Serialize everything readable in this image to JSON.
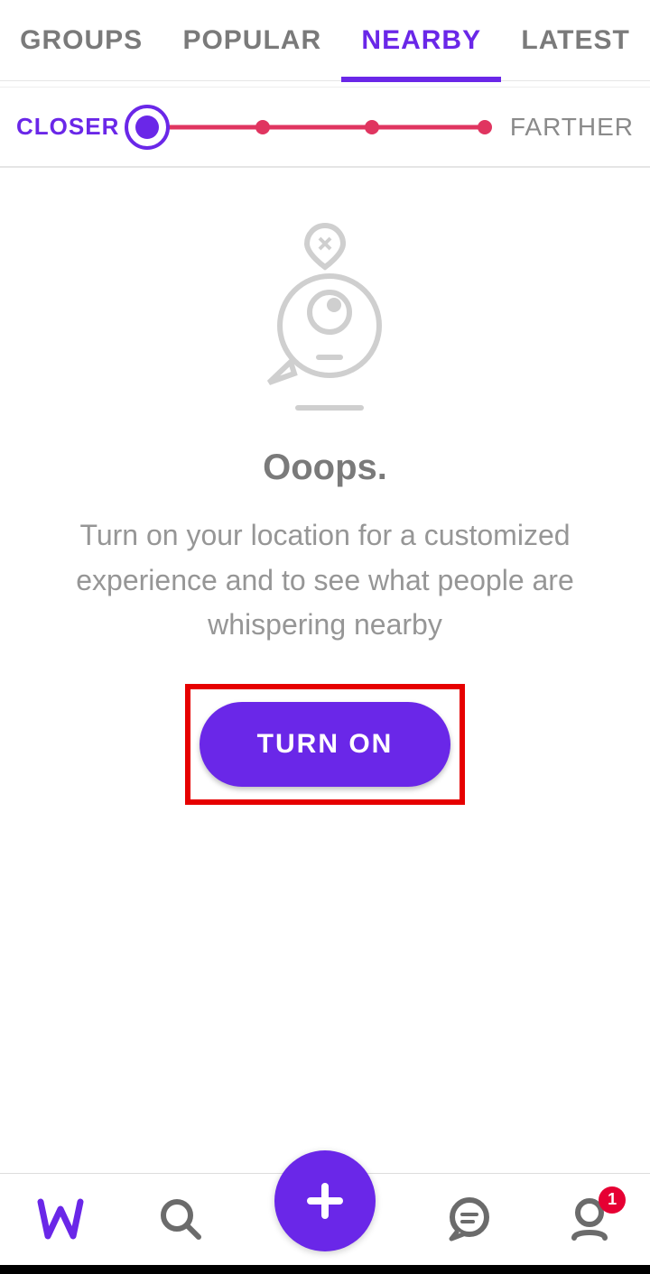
{
  "tabs": {
    "groups": "GROUPS",
    "popular": "POPULAR",
    "nearby": "NEARBY",
    "latest": "LATEST",
    "active": "nearby"
  },
  "slider": {
    "closer": "CLOSER",
    "farther": "FARTHER"
  },
  "empty": {
    "title": "Ooops.",
    "body": "Turn on your location for a customized experience and to see what people are whispering nearby",
    "button": "TURN ON"
  },
  "nav": {
    "badge_count": "1"
  }
}
